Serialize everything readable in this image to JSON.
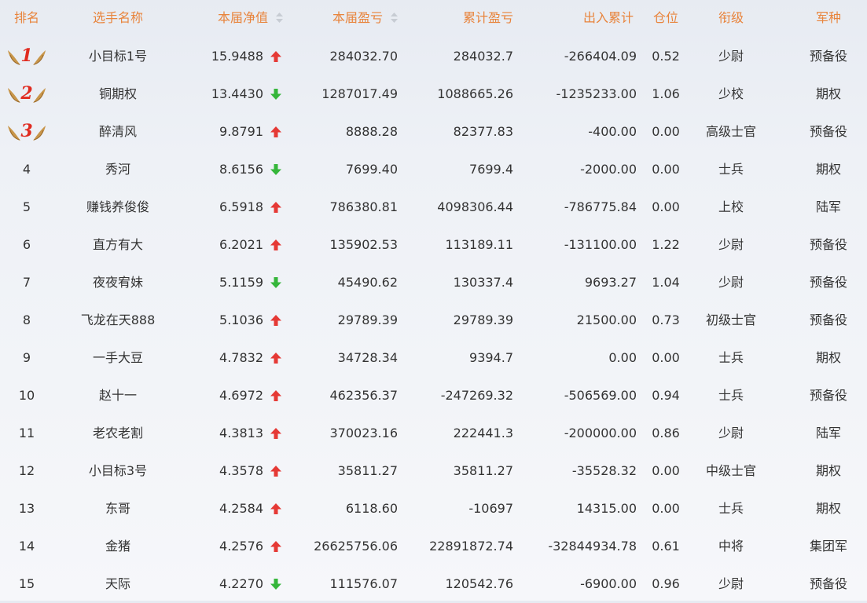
{
  "table": {
    "headers": {
      "rank": "排名",
      "player": "选手名称",
      "nav": "本届净值",
      "session_pnl": "本届盈亏",
      "cumulative_pnl": "累计盈亏",
      "net_flow": "出入累计",
      "position": "仓位",
      "military_rank": "衔级",
      "branch": "军种"
    },
    "sortable_columns": [
      "nav",
      "session_pnl"
    ],
    "colors": {
      "header_text": "#e8843c",
      "up_arrow": "#e53935",
      "down_arrow": "#35b63a",
      "medal_number": "#e02b20",
      "wing": "#c8964a"
    },
    "rows": [
      {
        "rank": "1",
        "medal": true,
        "player": "小目标1号",
        "nav": "15.9488",
        "trend": "up",
        "session_pnl": "284032.70",
        "cumulative_pnl": "284032.7",
        "net_flow": "-266404.09",
        "position": "0.52",
        "military_rank": "少尉",
        "branch": "预备役"
      },
      {
        "rank": "2",
        "medal": true,
        "player": "铜期权",
        "nav": "13.4430",
        "trend": "down",
        "session_pnl": "1287017.49",
        "cumulative_pnl": "1088665.26",
        "net_flow": "-1235233.00",
        "position": "1.06",
        "military_rank": "少校",
        "branch": "期权"
      },
      {
        "rank": "3",
        "medal": true,
        "player": "醉清风",
        "nav": "9.8791",
        "trend": "up",
        "session_pnl": "8888.28",
        "cumulative_pnl": "82377.83",
        "net_flow": "-400.00",
        "position": "0.00",
        "military_rank": "高级士官",
        "branch": "预备役"
      },
      {
        "rank": "4",
        "medal": false,
        "player": "秀河",
        "nav": "8.6156",
        "trend": "down",
        "session_pnl": "7699.40",
        "cumulative_pnl": "7699.4",
        "net_flow": "-2000.00",
        "position": "0.00",
        "military_rank": "士兵",
        "branch": "期权"
      },
      {
        "rank": "5",
        "medal": false,
        "player": "赚钱养俊俊",
        "nav": "6.5918",
        "trend": "up",
        "session_pnl": "786380.81",
        "cumulative_pnl": "4098306.44",
        "net_flow": "-786775.84",
        "position": "0.00",
        "military_rank": "上校",
        "branch": "陆军"
      },
      {
        "rank": "6",
        "medal": false,
        "player": "直方有大",
        "nav": "6.2021",
        "trend": "up",
        "session_pnl": "135902.53",
        "cumulative_pnl": "113189.11",
        "net_flow": "-131100.00",
        "position": "1.22",
        "military_rank": "少尉",
        "branch": "预备役"
      },
      {
        "rank": "7",
        "medal": false,
        "player": "夜夜宥妹",
        "nav": "5.1159",
        "trend": "down",
        "session_pnl": "45490.62",
        "cumulative_pnl": "130337.4",
        "net_flow": "9693.27",
        "position": "1.04",
        "military_rank": "少尉",
        "branch": "预备役"
      },
      {
        "rank": "8",
        "medal": false,
        "player": "飞龙在天888",
        "nav": "5.1036",
        "trend": "up",
        "session_pnl": "29789.39",
        "cumulative_pnl": "29789.39",
        "net_flow": "21500.00",
        "position": "0.73",
        "military_rank": "初级士官",
        "branch": "预备役"
      },
      {
        "rank": "9",
        "medal": false,
        "player": "一手大豆",
        "nav": "4.7832",
        "trend": "up",
        "session_pnl": "34728.34",
        "cumulative_pnl": "9394.7",
        "net_flow": "0.00",
        "position": "0.00",
        "military_rank": "士兵",
        "branch": "期权"
      },
      {
        "rank": "10",
        "medal": false,
        "player": "赵十一",
        "nav": "4.6972",
        "trend": "up",
        "session_pnl": "462356.37",
        "cumulative_pnl": "-247269.32",
        "net_flow": "-506569.00",
        "position": "0.94",
        "military_rank": "士兵",
        "branch": "预备役"
      },
      {
        "rank": "11",
        "medal": false,
        "player": "老农老割",
        "nav": "4.3813",
        "trend": "up",
        "session_pnl": "370023.16",
        "cumulative_pnl": "222441.3",
        "net_flow": "-200000.00",
        "position": "0.86",
        "military_rank": "少尉",
        "branch": "陆军"
      },
      {
        "rank": "12",
        "medal": false,
        "player": "小目标3号",
        "nav": "4.3578",
        "trend": "up",
        "session_pnl": "35811.27",
        "cumulative_pnl": "35811.27",
        "net_flow": "-35528.32",
        "position": "0.00",
        "military_rank": "中级士官",
        "branch": "期权"
      },
      {
        "rank": "13",
        "medal": false,
        "player": "东哥",
        "nav": "4.2584",
        "trend": "up",
        "session_pnl": "6118.60",
        "cumulative_pnl": "-10697",
        "net_flow": "14315.00",
        "position": "0.00",
        "military_rank": "士兵",
        "branch": "期权"
      },
      {
        "rank": "14",
        "medal": false,
        "player": "金猪",
        "nav": "4.2576",
        "trend": "up",
        "session_pnl": "26625756.06",
        "cumulative_pnl": "22891872.74",
        "net_flow": "-32844934.78",
        "position": "0.61",
        "military_rank": "中将",
        "branch": "集团军"
      },
      {
        "rank": "15",
        "medal": false,
        "player": "天际",
        "nav": "4.2270",
        "trend": "down",
        "session_pnl": "111576.07",
        "cumulative_pnl": "120542.76",
        "net_flow": "-6900.00",
        "position": "0.96",
        "military_rank": "少尉",
        "branch": "预备役"
      }
    ]
  }
}
